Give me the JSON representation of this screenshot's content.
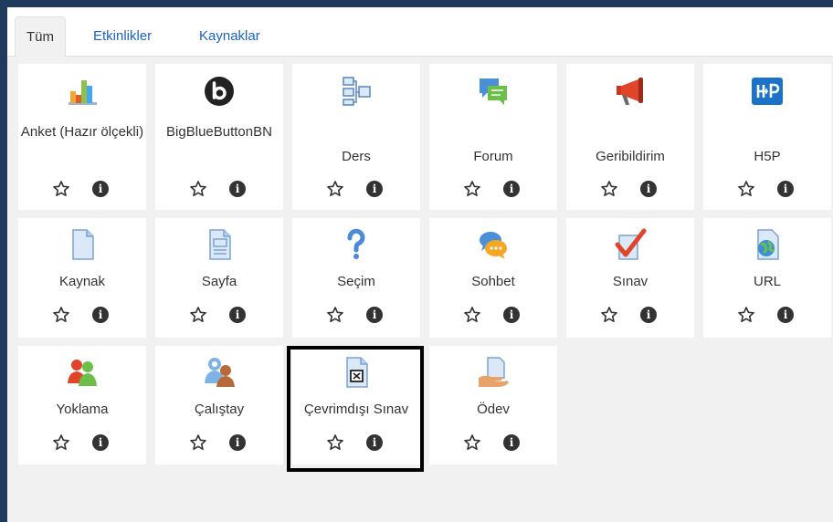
{
  "tabs": [
    {
      "label": "Tüm",
      "active": true
    },
    {
      "label": "Etkinlikler",
      "active": false
    },
    {
      "label": "Kaynaklar",
      "active": false
    }
  ],
  "modules": [
    {
      "name": "Anket (Hazır ölçekli)",
      "icon": "bar-chart-icon"
    },
    {
      "name": "BigBlueButtonBN",
      "icon": "bigbluebutton-icon"
    },
    {
      "name": "Ders",
      "icon": "lesson-flowchart-icon"
    },
    {
      "name": "Forum",
      "icon": "forum-chat-icon"
    },
    {
      "name": "Geribildirim",
      "icon": "megaphone-icon"
    },
    {
      "name": "H5P",
      "icon": "h5p-icon"
    },
    {
      "name": "Kaynak",
      "icon": "file-icon"
    },
    {
      "name": "Sayfa",
      "icon": "page-icon"
    },
    {
      "name": "Seçim",
      "icon": "question-mark-icon"
    },
    {
      "name": "Sohbet",
      "icon": "chat-bubbles-icon"
    },
    {
      "name": "Sınav",
      "icon": "quiz-checkmark-icon"
    },
    {
      "name": "URL",
      "icon": "url-globe-icon"
    },
    {
      "name": "Yoklama",
      "icon": "attendance-people-icon"
    },
    {
      "name": "Çalıştay",
      "icon": "workshop-people-icon"
    },
    {
      "name": "Çevrimdışı Sınav",
      "icon": "offline-quiz-icon"
    },
    {
      "name": "Ödev",
      "icon": "assignment-hand-icon"
    }
  ],
  "colors": {
    "tab_link": "#1a64c8",
    "background": "#f1f1f1",
    "page_edge": "#1f3a5c"
  }
}
